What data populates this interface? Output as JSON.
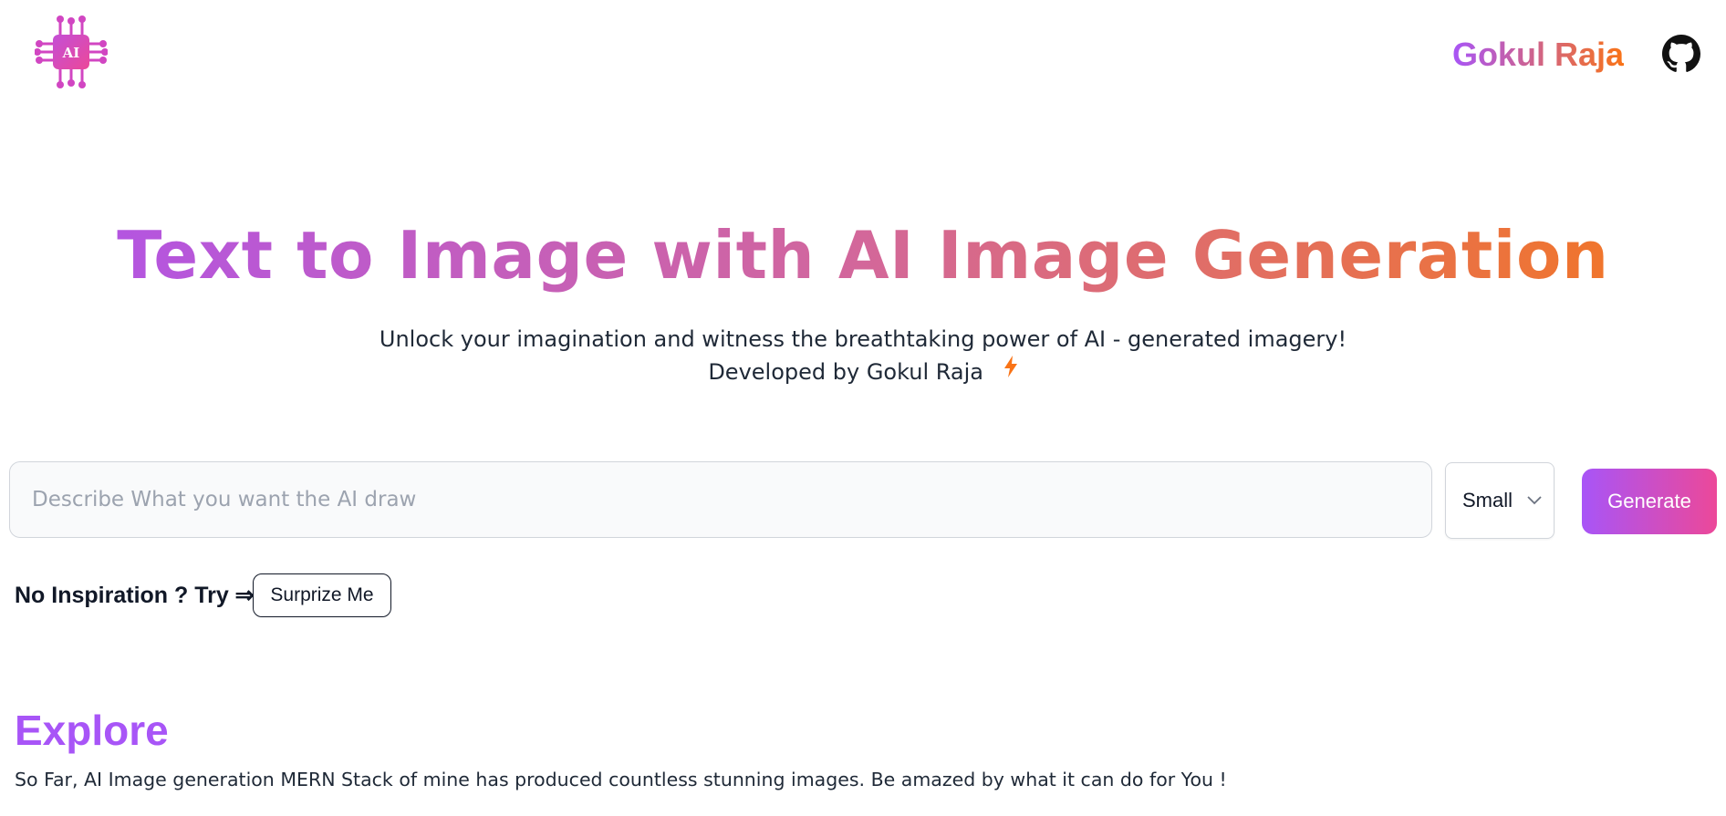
{
  "header": {
    "logo_text": "AI",
    "brand": "Gokul Raja",
    "github_icon": "github-icon"
  },
  "hero": {
    "title": "Text to Image with AI Image Generation",
    "subtitle": "Unlock your imagination and witness the breathtaking power of AI - generated imagery!",
    "developer_line": "Developed by Gokul Raja",
    "developer_icon": "lightning-bolt-icon"
  },
  "form": {
    "prompt_placeholder": "Describe What you want the AI draw",
    "prompt_value": "",
    "size_selected": "Small",
    "generate_label": "Generate"
  },
  "inspiration": {
    "label": "No Inspiration ? Try ⇒",
    "surprise_label": "Surprize Me"
  },
  "explore": {
    "title": "Explore",
    "description": "So Far, AI Image generation MERN Stack of mine has produced countless stunning images. Be amazed by what it can do for You !"
  },
  "colors": {
    "accent_purple": "#a855f7",
    "accent_pink": "#ec4899",
    "accent_orange": "#f97316"
  }
}
